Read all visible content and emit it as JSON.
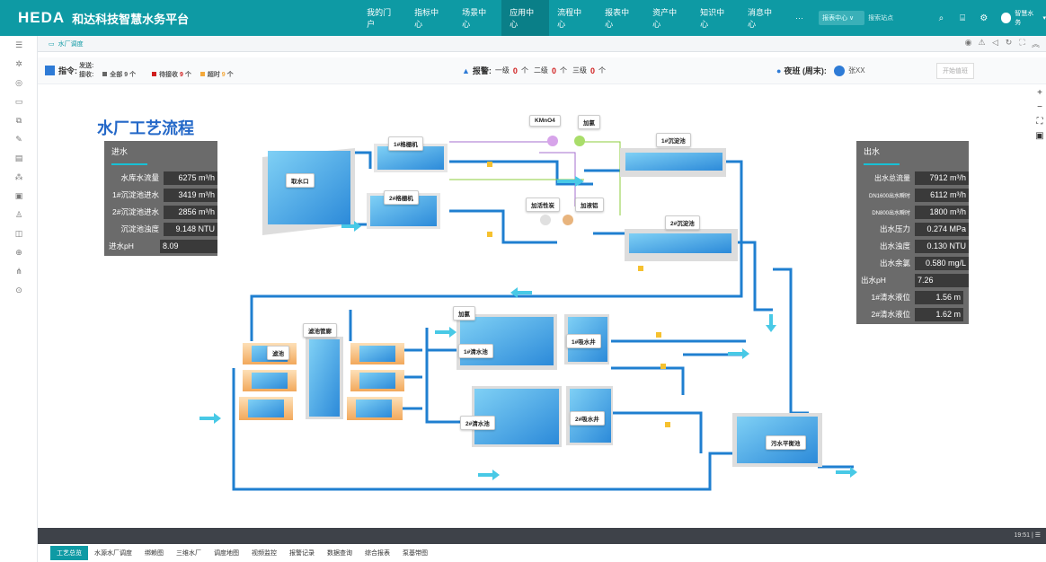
{
  "brand": {
    "logo": "HEDA",
    "name": "和达科技智慧水务平台"
  },
  "nav": [
    "我的门户",
    "指标中心",
    "场景中心",
    "应用中心",
    "流程中心",
    "报表中心",
    "资产中心",
    "知识中心",
    "消息中心",
    "···"
  ],
  "nav_active": 3,
  "topbar": {
    "select": "报表中心 ∨",
    "search_placeholder": "搜索站点",
    "user": "智慧水务"
  },
  "tab": {
    "label": "水厂调度"
  },
  "status": {
    "cmd_label": "指令:",
    "send_label": "发送:",
    "recv_label": "接收:",
    "all_label": "全部",
    "all_count": "9",
    "unit": "个",
    "pending_label": "待接收",
    "pending_count": "9",
    "overtime_label": "超时",
    "overtime_count": "9",
    "alarm_label": "报警:",
    "lvl1": "一级",
    "lvl1_count": "0",
    "lvl2": "二级",
    "lvl2_count": "0",
    "lvl3": "三级",
    "lvl3_count": "0",
    "duty_label": "夜班 (周末):",
    "duty_name": "张XX",
    "start_button": "开始值班"
  },
  "title": "水厂工艺流程",
  "inlet": {
    "header": "进水",
    "rows": [
      {
        "label": "水库水流量",
        "value": "6275  m³/h"
      },
      {
        "label": "1#沉淀池进水",
        "value": "3419  m³/h"
      },
      {
        "label": "2#沉淀池进水",
        "value": "2856  m³/h"
      },
      {
        "label": "沉淀池浊度",
        "value": "9.148 NTU"
      },
      {
        "label": "进水pH",
        "value": "8.09"
      }
    ]
  },
  "outlet": {
    "header": "出水",
    "rows": [
      {
        "label": "出水总流量",
        "value": "7912  m³/h"
      },
      {
        "label": "DN1600出水瞬时",
        "value": "6112  m³/h"
      },
      {
        "label": "DN800出水瞬时",
        "value": "1800  m³/h"
      },
      {
        "label": "出水压力",
        "value": "0.274  MPa"
      },
      {
        "label": "出水浊度",
        "value": "0.130  NTU"
      },
      {
        "label": "出水余氯",
        "value": "0.580  mg/L"
      },
      {
        "label": "出水pH",
        "value": "7.26"
      },
      {
        "label": "1#清水液位",
        "value": "1.56    m"
      },
      {
        "label": "2#清水液位",
        "value": "1.62    m"
      }
    ]
  },
  "labels": {
    "intake": "取水口",
    "screen1": "1#格栅机",
    "screen2": "2#格栅机",
    "kmno4": "KMnO4",
    "chlorine": "加氯",
    "carbon": "加活性炭",
    "pac": "加液铝",
    "settle1": "1#沉淀池",
    "settle2": "2#沉淀池",
    "filter_pipe": "滤池管廊",
    "filter": "滤池",
    "chlor2": "加氯",
    "clear1": "1#清水池",
    "clear2": "2#清水池",
    "suction1": "1#吸水井",
    "suction2": "2#吸水井",
    "waste": "污水平衡池"
  },
  "footer": {
    "time": "19:51",
    "sep": "|  ☰"
  },
  "bottom_tabs": [
    "工艺总览",
    "水源水厂调度",
    "绑赖图",
    "三维水厂",
    "调度地图",
    "视频监控",
    "报警记录",
    "数据查询",
    "综合报表",
    "泵基带图"
  ],
  "colors": {
    "primary": "#0e9aa4",
    "pipe": "#1f7fd0",
    "water": "#3fa7e6"
  }
}
